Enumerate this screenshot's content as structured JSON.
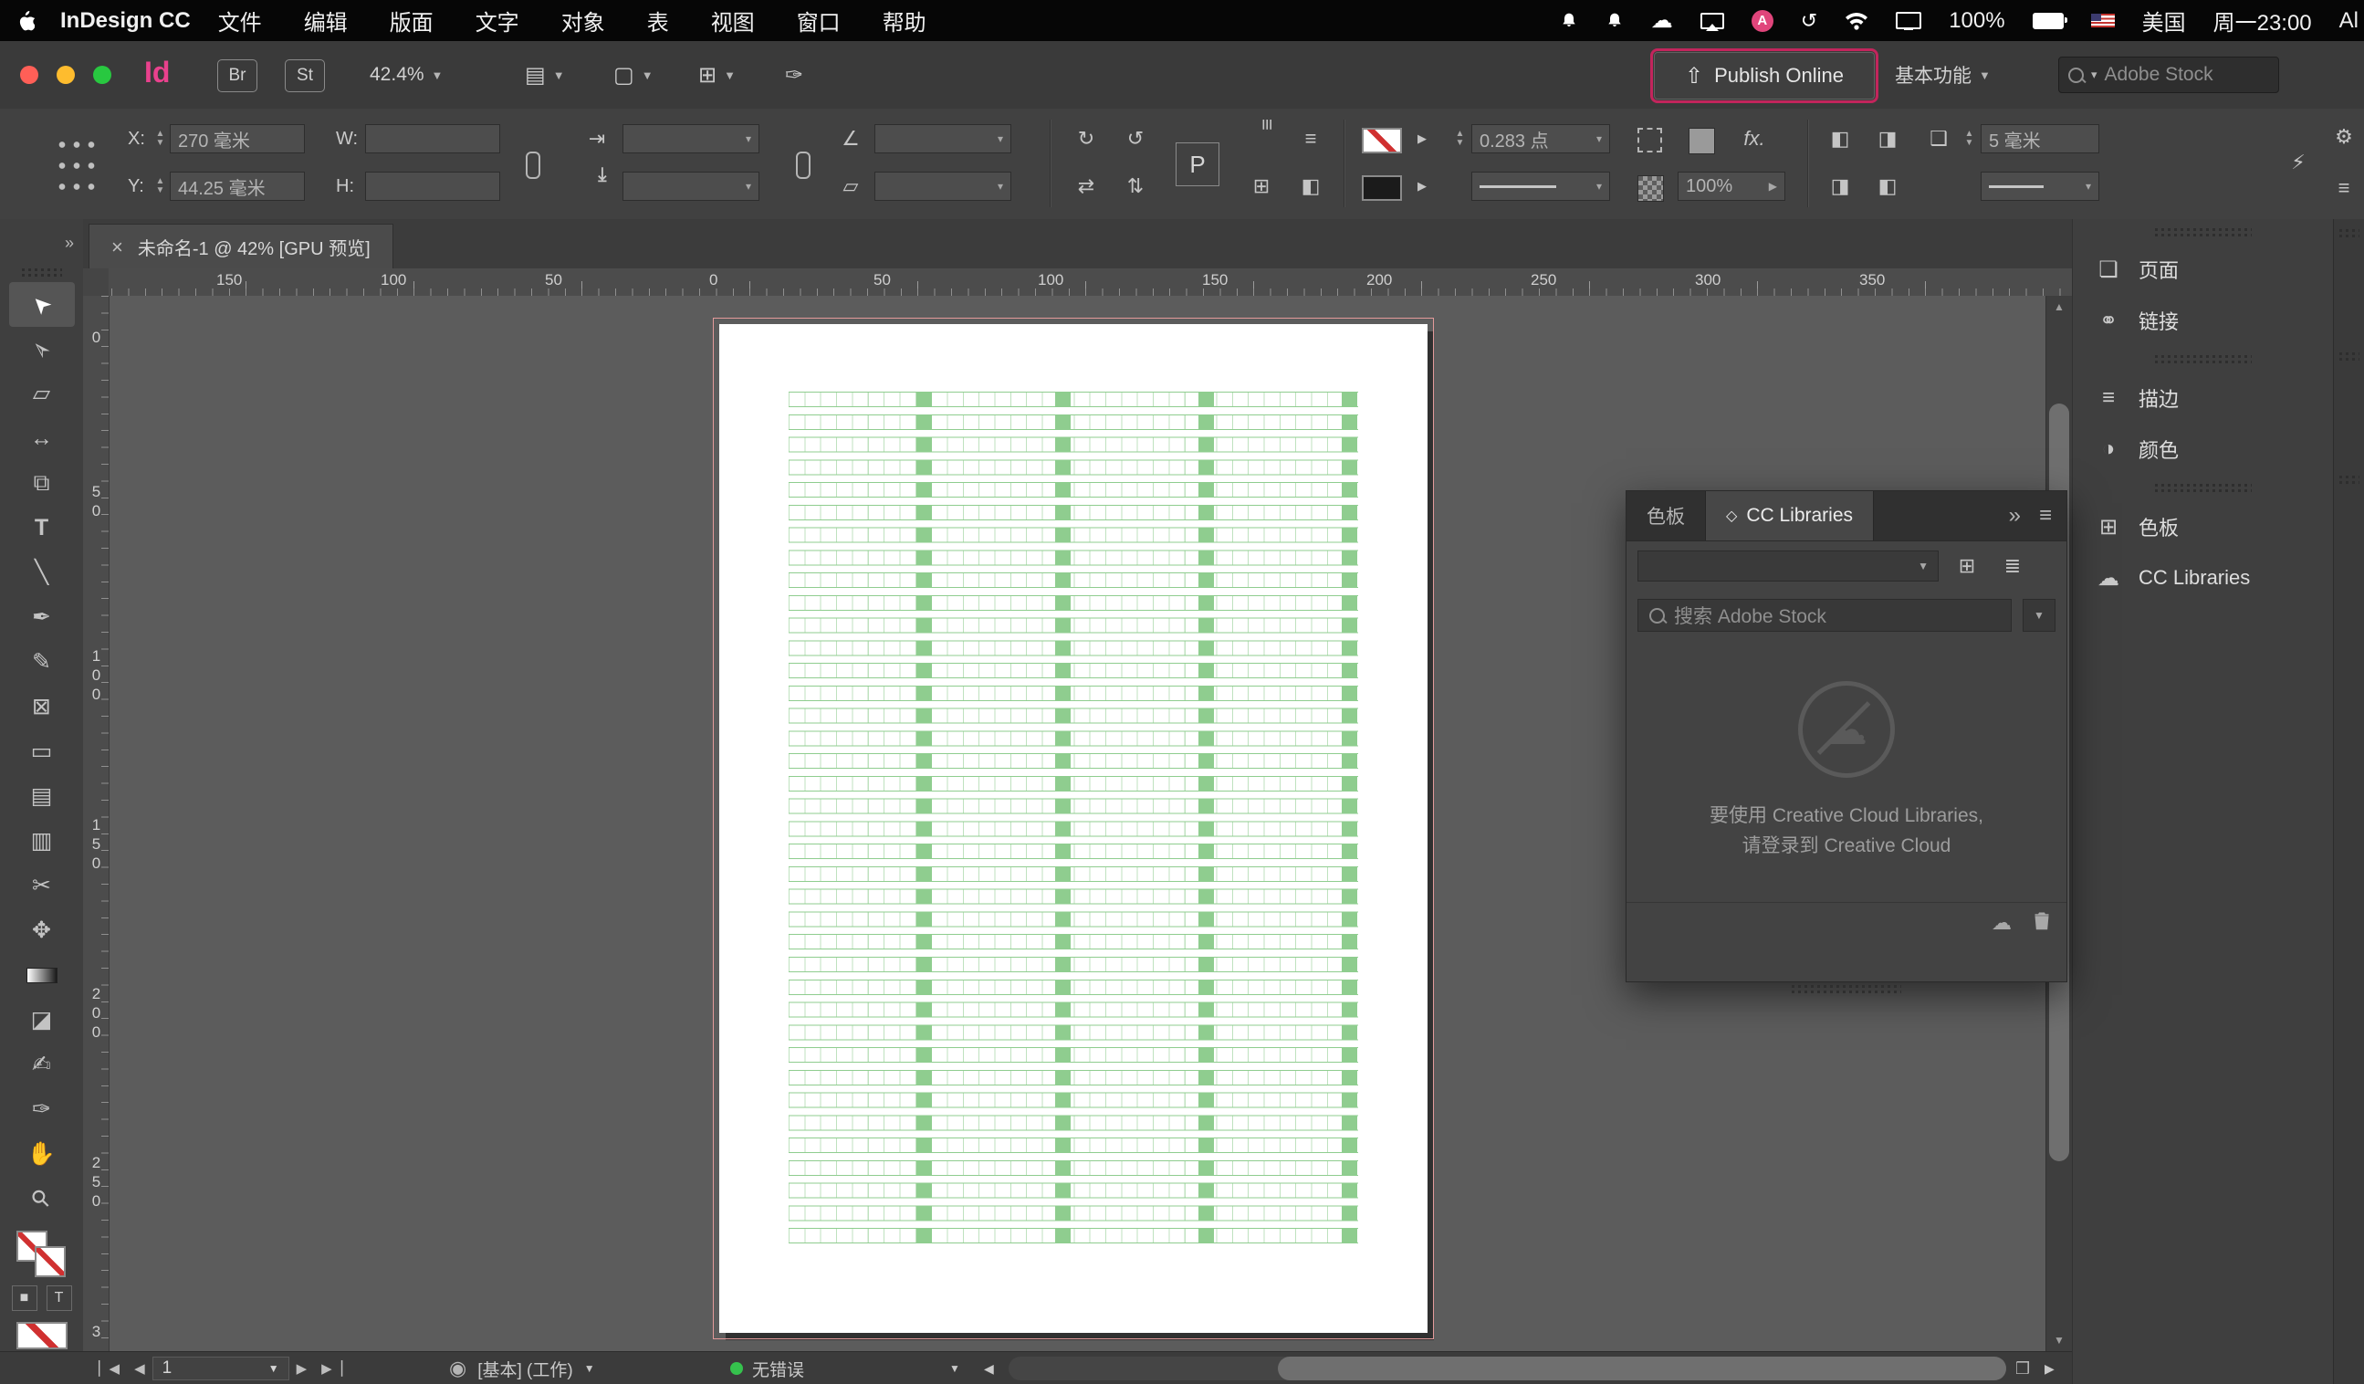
{
  "menubar": {
    "app_name": "InDesign CC",
    "menus": [
      "文件",
      "编辑",
      "版面",
      "文字",
      "对象",
      "表",
      "视图",
      "窗口",
      "帮助"
    ],
    "battery": "100%",
    "input_source": "美国",
    "clock": "周一23:00",
    "overflow": "Al",
    "badge_letter": "A"
  },
  "titlebar": {
    "id_badge": "Id",
    "bridge_badge": "Br",
    "stock_badge": "St",
    "zoom_level": "42.4%",
    "publish_online": "Publish Online",
    "workspace": "基本功能",
    "stock_search_placeholder": "Adobe Stock"
  },
  "control": {
    "x_label": "X:",
    "x_value": "270 毫米",
    "y_label": "Y:",
    "y_value": "44.25 毫米",
    "w_label": "W:",
    "h_label": "H:",
    "stroke_weight": "0.283 点",
    "fx": "fx.",
    "opacity": "100%",
    "corner_size": "5 毫米",
    "p_badge": "P"
  },
  "doc_tab": {
    "title": "未命名-1 @ 42% [GPU 预览]"
  },
  "rulers": {
    "horizontal": [
      "150",
      "100",
      "50",
      "0",
      "50",
      "100",
      "150",
      "200",
      "250",
      "300",
      "350"
    ],
    "vertical": [
      "0",
      "50",
      "100",
      "150",
      "200",
      "250",
      "3"
    ]
  },
  "tools": [
    {
      "name": "selection",
      "glyph": "➤"
    },
    {
      "name": "direct-selection",
      "glyph": "➢"
    },
    {
      "name": "page",
      "glyph": "▱"
    },
    {
      "name": "gap",
      "glyph": "↔"
    },
    {
      "name": "content-collector",
      "glyph": "⧉"
    },
    {
      "name": "type",
      "glyph": "T"
    },
    {
      "name": "line",
      "glyph": "╲"
    },
    {
      "name": "pen",
      "glyph": "✒"
    },
    {
      "name": "pencil",
      "glyph": "✎"
    },
    {
      "name": "rectangle-frame",
      "glyph": "⊠"
    },
    {
      "name": "rectangle",
      "glyph": "▭"
    },
    {
      "name": "horizontal-grid",
      "glyph": "▤"
    },
    {
      "name": "vertical-grid",
      "glyph": "▥"
    },
    {
      "name": "scissors",
      "glyph": "✂"
    },
    {
      "name": "free-transform",
      "glyph": "✥"
    },
    {
      "name": "gradient-swatch",
      "glyph": ""
    },
    {
      "name": "gradient-feather",
      "glyph": "◪"
    },
    {
      "name": "note",
      "glyph": "✍"
    },
    {
      "name": "eyedropper",
      "glyph": "✑"
    },
    {
      "name": "hand",
      "glyph": "✋"
    },
    {
      "name": "zoom",
      "glyph": "⚲"
    }
  ],
  "cc_panel": {
    "tab_swatches": "色板",
    "tab_icon": "◇",
    "tab_libraries": "CC Libraries",
    "search_placeholder": "搜索 Adobe Stock",
    "empty_text_1": "要使用 Creative Cloud Libraries,",
    "empty_text_2": "请登录到 Creative Cloud"
  },
  "dock": {
    "items": [
      {
        "label": "页面",
        "icon": "❏"
      },
      {
        "label": "链接",
        "icon": "⚭"
      },
      {
        "label": "描边",
        "icon": "≡"
      },
      {
        "label": "颜色",
        "icon": "◑"
      },
      {
        "label": "色板",
        "icon": "⊞"
      },
      {
        "label": "CC Libraries",
        "icon": "☁"
      }
    ]
  },
  "statusbar": {
    "page_number": "1",
    "preflight_profile": "[基本] (工作)",
    "preflight_status": "无错误"
  },
  "glyphs": {
    "caret": "▼",
    "caret_sm": "▾",
    "spin_up": "▲",
    "spin_down": "▼",
    "play": "▶",
    "play_left": "◀",
    "close": "×",
    "chevrons": "»",
    "menu": "≡",
    "gear": "⚙",
    "quick_apply": "⚡",
    "rotate_cw": "↻",
    "rotate_ccw": "↺",
    "swap_h": "⇄",
    "swap_v": "⇅",
    "scale": "⇥",
    "angle": "∠",
    "shear": "▱",
    "up_share": "⇧",
    "first_page": "▏◀",
    "last_page": "▶▕",
    "preflight": "◉",
    "corner_box": "❒",
    "grid_view": "⊞",
    "list_view": "≣",
    "cloud": "☁",
    "view_options": "▤",
    "screen_mode": "▢",
    "arrange_docs": "⊞",
    "quill": "✑",
    "wrap1": "◧",
    "wrap2": "◨",
    "align_rows": "≡",
    "frame_corner": "❑",
    "mini_fill": "■",
    "mini_text": "T",
    "bell": "🔔"
  },
  "colors": {
    "grid_green": "#8fcd8f",
    "publish_outline": "#c2255c",
    "status_green": "#35c24d",
    "brand_pink": "#e9418d"
  }
}
